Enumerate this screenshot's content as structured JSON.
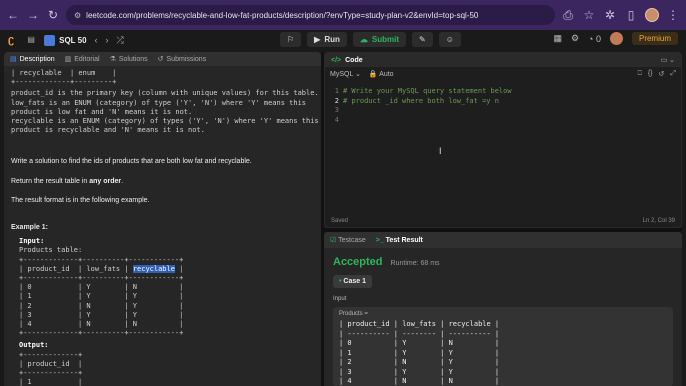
{
  "browser": {
    "url": "leetcode.com/problems/recyclable-and-low-fat-products/description/?envType=study-plan-v2&envId=top-sql-50"
  },
  "appbar": {
    "list_name": "SQL 50",
    "run_label": "Run",
    "submit_label": "Submit",
    "streak_count": "0",
    "premium_label": "Premium"
  },
  "left_tabs": {
    "description": "Description",
    "editorial": "Editorial",
    "solutions": "Solutions",
    "submissions": "Submissions"
  },
  "description": {
    "schema_tail": "| recyclable  | enum    |\n+-------------+---------+",
    "schema_notes": "product_id is the primary key (column with unique values) for this table.\nlow_fats is an ENUM (category) of type ('Y', 'N') where 'Y' means this\nproduct is low fat and 'N' means it is not.\nrecyclable is an ENUM (category) of types ('Y', 'N') where 'Y' means this\nproduct is recyclable and 'N' means it is not.",
    "task": "Write a solution to find the ids of products that are both low fat and recyclable.",
    "order_prefix": "Return the result table in ",
    "order_bold": "any order",
    "order_suffix": ".",
    "format": "The result format is in the following example.",
    "example_title": "Example 1:",
    "input_label": "Input:",
    "table_label": "Products table:",
    "table_top": "+-------------+----------+------------+",
    "table_header_pre": "| product_id  | low_fats | ",
    "table_header_hl": "recyclable",
    "table_header_post": " |",
    "table_rows": "+-------------+----------+------------+\n| 0           | Y        | N          |\n| 1           | Y        | Y          |\n| 2           | N        | Y          |\n| 3           | Y        | Y          |\n| 4           | N        | N          |\n+-------------+----------+------------+",
    "output_label": "Output:",
    "output_table": "+-------------+\n| product_id  |\n+-------------+\n| 1           |"
  },
  "code": {
    "title": "Code",
    "language": "MySQL",
    "mode": "Auto",
    "line_numbers": [
      "1",
      "2",
      "3",
      "4"
    ],
    "lines": [
      "# Write your MySQL query statement below",
      "# product _id where both low_fat =y n",
      "",
      ""
    ],
    "saved": "Saved",
    "position": "Ln 2, Col 39"
  },
  "result": {
    "testcase_tab": "Testcase",
    "result_tab": "Test Result",
    "status": "Accepted",
    "runtime": "Runtime: 68 ms",
    "case_label": "Case 1",
    "input_label": "Input",
    "products_label": "Products =",
    "table": "| product_id | low_fats | recyclable |\n| ---------- | -------- | ---------- |\n| 0          | Y        | N          |\n| 1          | Y        | Y          |\n| 2          | N        | Y          |\n| 3          | Y        | Y          |\n| 4          | N        | N          |"
  }
}
